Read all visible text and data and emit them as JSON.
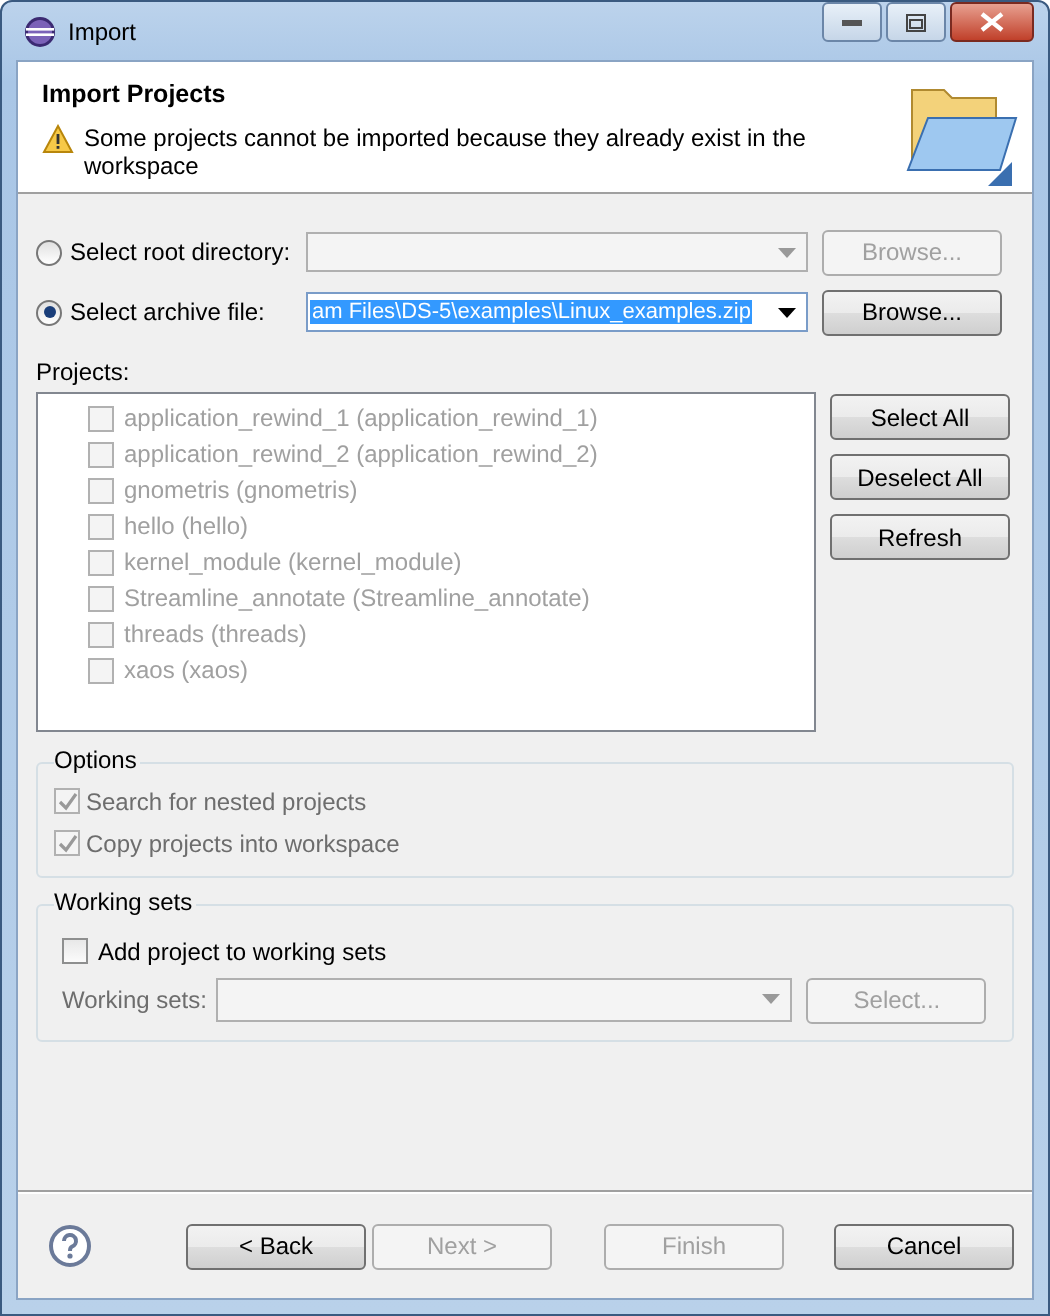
{
  "window": {
    "title": "Import"
  },
  "header": {
    "title": "Import Projects",
    "message": "Some projects cannot be imported because they already exist in the workspace"
  },
  "source": [
    {
      "label": "Select root directory:",
      "selected": false,
      "browse": {
        "label": "Browse...",
        "disabled": true
      }
    },
    {
      "label": "Select archive file:",
      "selected": true,
      "value": "am Files\\DS-5\\examples\\Linux_examples.zip",
      "browse": {
        "label": "Browse...",
        "disabled": false
      }
    }
  ],
  "projects": {
    "label": "Projects:",
    "items": [
      {
        "label": "application_rewind_1 (application_rewind_1)",
        "checked": false,
        "disabled": true
      },
      {
        "label": "application_rewind_2 (application_rewind_2)",
        "checked": false,
        "disabled": true
      },
      {
        "label": "gnometris (gnometris)",
        "checked": false,
        "disabled": true
      },
      {
        "label": "hello (hello)",
        "checked": false,
        "disabled": true
      },
      {
        "label": "kernel_module (kernel_module)",
        "checked": false,
        "disabled": true
      },
      {
        "label": "Streamline_annotate (Streamline_annotate)",
        "checked": false,
        "disabled": true
      },
      {
        "label": "threads (threads)",
        "checked": false,
        "disabled": true
      },
      {
        "label": "xaos (xaos)",
        "checked": false,
        "disabled": true
      }
    ],
    "buttons": [
      "Select All",
      "Deselect All",
      "Refresh"
    ]
  },
  "options": {
    "title": "Options",
    "items": [
      {
        "label": "Search for nested projects",
        "checked": true,
        "disabled": true
      },
      {
        "label": "Copy projects into workspace",
        "checked": true,
        "disabled": true
      }
    ]
  },
  "working_sets": {
    "title": "Working sets",
    "checkbox": {
      "label": "Add project to working sets",
      "checked": false,
      "disabled": false
    },
    "field_label": "Working sets:",
    "select": {
      "label": "Select...",
      "disabled": true
    }
  },
  "footer": [
    {
      "label": "< Back",
      "disabled": false
    },
    {
      "label": "Next >",
      "disabled": true
    },
    {
      "label": "Finish",
      "disabled": true
    },
    {
      "label": "Cancel",
      "disabled": false
    }
  ]
}
